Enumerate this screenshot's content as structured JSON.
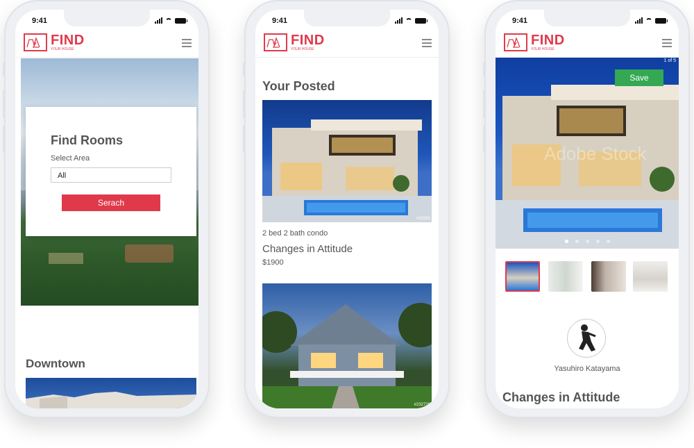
{
  "status": {
    "time": "9:41"
  },
  "brand": {
    "name": "FIND",
    "tagline": "YOUR HOUSE"
  },
  "screen1": {
    "find_title": "Find Rooms",
    "select_label": "Select Area",
    "select_value": "All",
    "search_button": "Serach",
    "section_title": "Downtown"
  },
  "screen2": {
    "section_title": "Your Posted",
    "listing": {
      "type": "2 bed 2 bath condo",
      "title": "Changes in Attitude",
      "price": "$1900"
    },
    "photo1_code": "#23355",
    "photo2_code": "#232726"
  },
  "screen3": {
    "counter": "1 of 5",
    "save_button": "Save",
    "watermark": "Adobe Stock",
    "owner_name": "Yasuhiro Katayama",
    "title": "Changes in Attitude",
    "carousel_dots": 5,
    "carousel_active": 1
  },
  "colors": {
    "accent": "#e03a4a",
    "save": "#34a853"
  }
}
